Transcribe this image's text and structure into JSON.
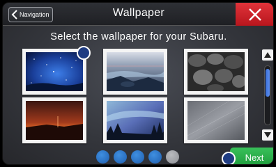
{
  "header": {
    "back_label": "Navigation",
    "title": "Wallpaper",
    "close_icon": "close-icon"
  },
  "prompt": "Select the wallpaper for your Subaru.",
  "wallpapers": [
    {
      "name": "starry-blue-night",
      "selected": true
    },
    {
      "name": "rocky-seashore-dusk",
      "selected": false
    },
    {
      "name": "dark-pebbles",
      "selected": false
    },
    {
      "name": "red-sunset-landscape",
      "selected": false
    },
    {
      "name": "aurora-forest-night",
      "selected": false
    },
    {
      "name": "silver-texture",
      "selected": false
    }
  ],
  "pagination": {
    "total": 5,
    "current": 4
  },
  "next_label": "Next",
  "colors": {
    "close": "#c8202a",
    "next": "#2bb04a",
    "accent": "#2f74c9",
    "marker": "#1f3c82"
  }
}
